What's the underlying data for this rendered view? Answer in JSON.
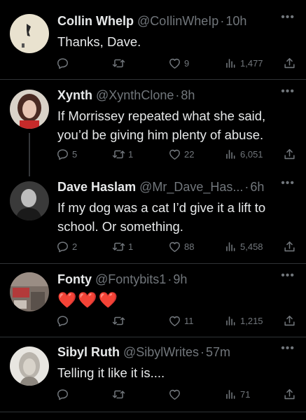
{
  "tweets": [
    {
      "name": "Collin Whelp",
      "handle": "@CoIlinWheIp",
      "sep": "·",
      "time": "10h",
      "text": "Thanks, Dave.",
      "replies": "",
      "retweets": "",
      "likes": "9",
      "views": "1,477"
    },
    {
      "name": "Xynth",
      "handle": "@XynthClone",
      "sep": "·",
      "time": "8h",
      "text": "If Morrissey repeated what she said, you’d be giving him plenty of abuse.",
      "replies": "5",
      "retweets": "1",
      "likes": "22",
      "views": "6,051"
    },
    {
      "name": "Dave Haslam",
      "handle": "@Mr_Dave_Has...",
      "sep": "·",
      "time": "6h",
      "text": "If my dog was a cat I’d give it a lift to school. Or something.",
      "replies": "2",
      "retweets": "1",
      "likes": "88",
      "views": "5,458"
    },
    {
      "name": "Fonty",
      "handle": "@Fontybits1",
      "sep": "·",
      "time": "9h",
      "text": "❤️❤️❤️",
      "replies": "",
      "retweets": "",
      "likes": "11",
      "views": "1,215"
    },
    {
      "name": "Sibyl Ruth",
      "handle": "@SibylWrites",
      "sep": "·",
      "time": "57m",
      "text": "Telling it like it is....",
      "replies": "",
      "retweets": "",
      "likes": "",
      "views": "71"
    }
  ],
  "icons": {
    "more": "more-icon",
    "reply": "reply-icon",
    "retweet": "retweet-icon",
    "like": "heart-icon",
    "views": "views-icon",
    "share": "share-icon"
  },
  "colors": {
    "background": "#000000",
    "text": "#e7e9ea",
    "secondary": "#71767b",
    "divider": "#2f3336",
    "heart_emoji": "#f4212e"
  }
}
